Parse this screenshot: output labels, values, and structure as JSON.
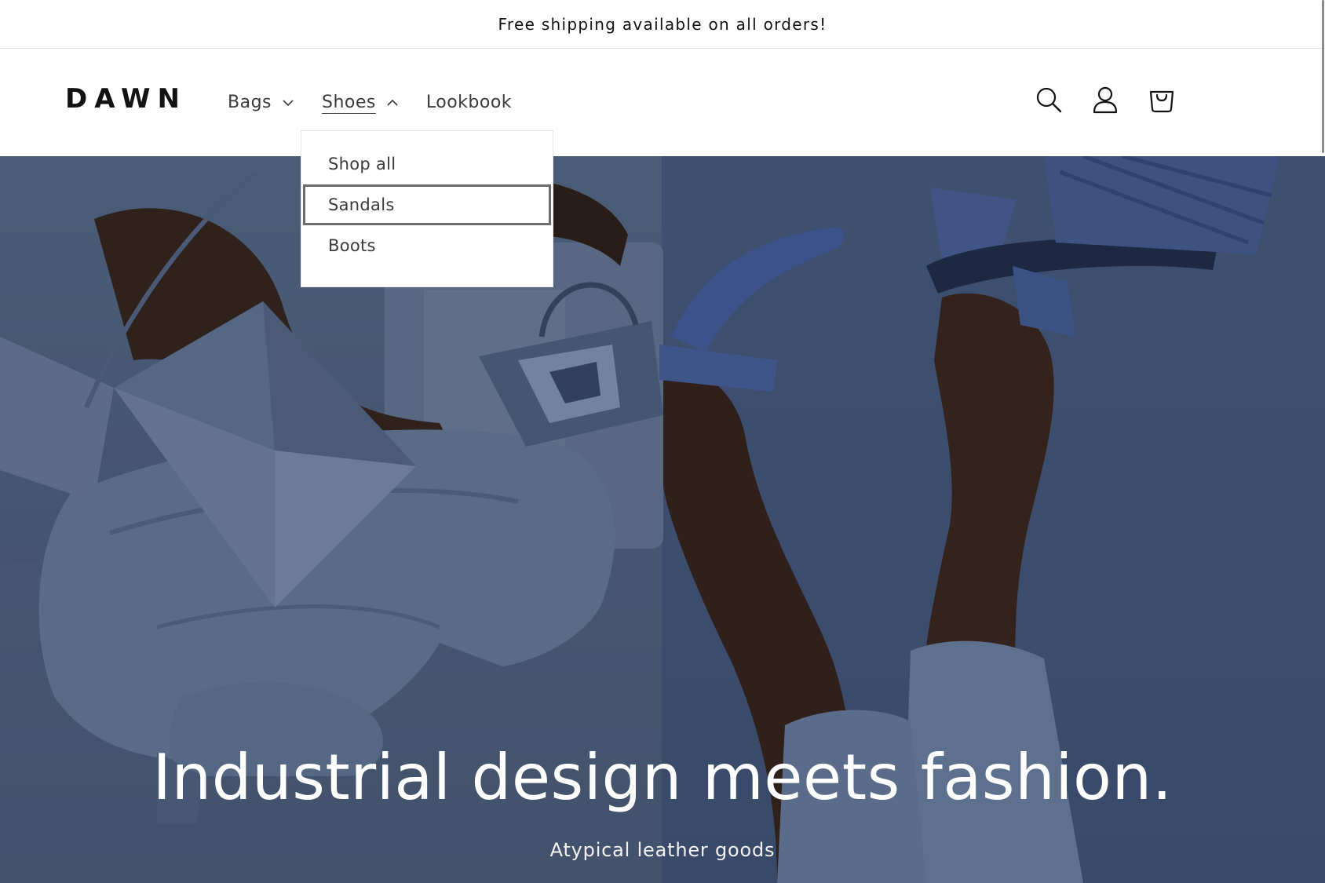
{
  "announcement": {
    "text": "Free shipping available on all orders!"
  },
  "header": {
    "logo": "DAWN",
    "nav": [
      {
        "label": "Bags"
      },
      {
        "label": "Shoes"
      },
      {
        "label": "Lookbook"
      }
    ],
    "icons": {
      "search": "search-icon",
      "account": "account-icon",
      "cart": "cart-icon"
    }
  },
  "dropdown": {
    "items": [
      {
        "label": "Shop all"
      },
      {
        "label": "Sandals"
      },
      {
        "label": "Boots"
      }
    ]
  },
  "hero": {
    "title": "Industrial design meets fashion.",
    "subtitle": "Atypical leather goods"
  },
  "colors": {
    "hero_left": "#55698a",
    "hero_right": "#4a5f86",
    "text": "#121212"
  }
}
